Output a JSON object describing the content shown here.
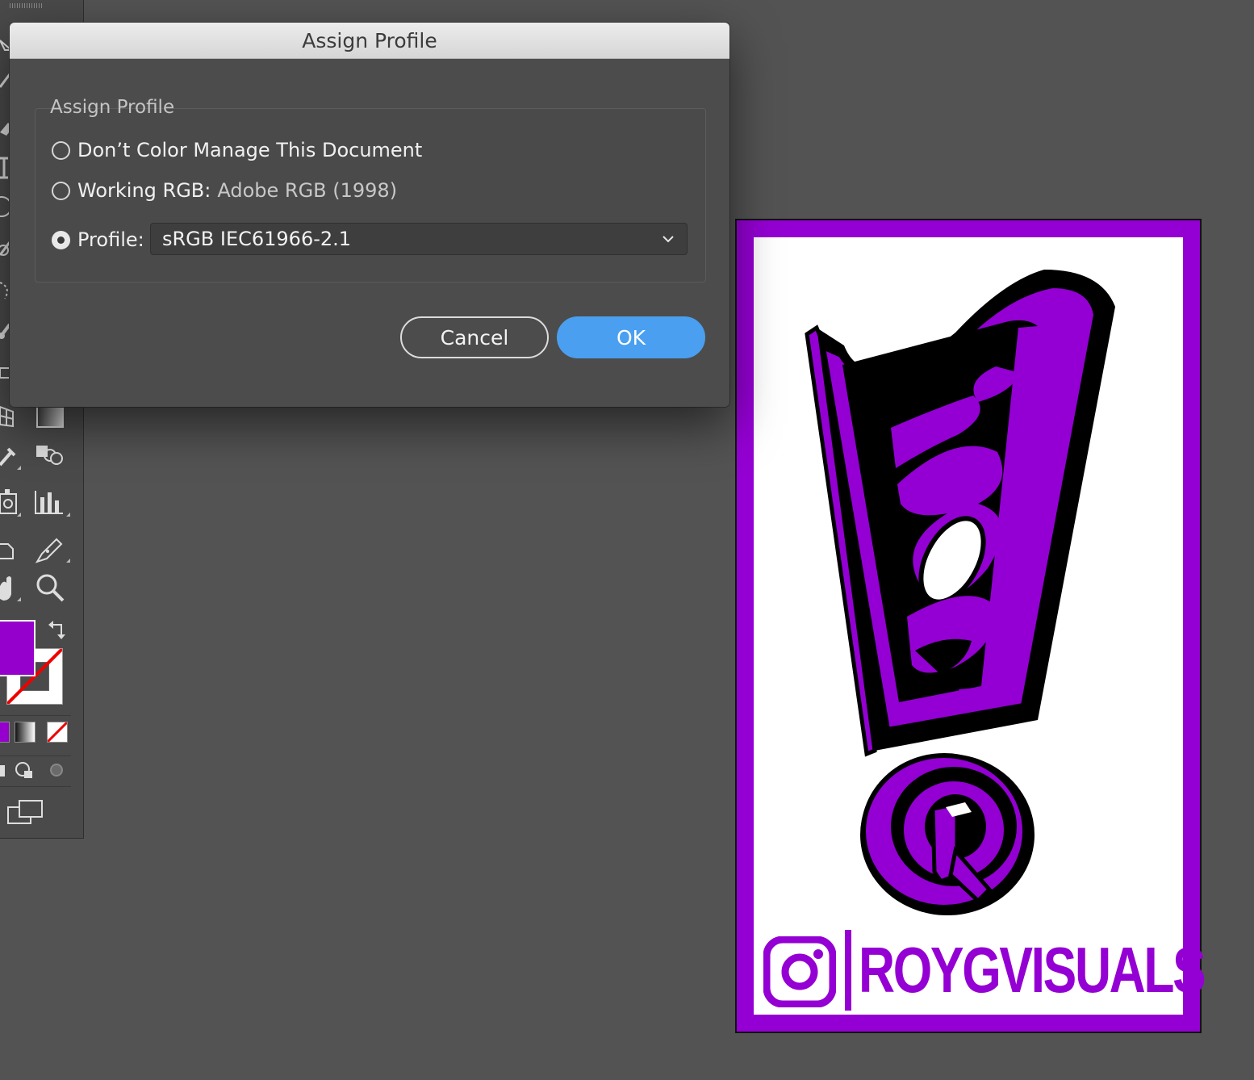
{
  "dialog": {
    "title": "Assign Profile",
    "group_label": "Assign Profile",
    "options": [
      {
        "label": "Don’t Color Manage This Document",
        "value": "",
        "checked": false
      },
      {
        "label": "Working RGB:",
        "value": "Adobe RGB (1998)",
        "checked": false
      },
      {
        "label": "Profile:",
        "value": "",
        "checked": true
      }
    ],
    "profile_select": {
      "selected": "sRGB IEC61966-2.1"
    },
    "buttons": {
      "cancel": "Cancel",
      "ok": "OK"
    }
  },
  "artboard": {
    "handle_text": "ROYGVISUALS",
    "colors": {
      "accent": "#9400d3",
      "outline": "#000000",
      "paper": "#ffffff"
    }
  },
  "toolbar": {
    "fill_color": "#9500cc",
    "stroke_color": "none",
    "tools": [
      "direct-selection-icon",
      "pen-icon",
      "eraser-icon",
      "type-icon",
      "ellipse-icon",
      "rotate-icon",
      "lasso-icon",
      "brush-icon",
      "shape-builder-icon",
      "mesh-icon",
      "gradient-icon",
      "eyedropper-icon",
      "blend-icon",
      "symbol-sprayer-icon",
      "column-graph-icon",
      "artboard-icon",
      "slice-icon",
      "hand-icon",
      "zoom-icon",
      "swap-fill-stroke-icon"
    ]
  }
}
